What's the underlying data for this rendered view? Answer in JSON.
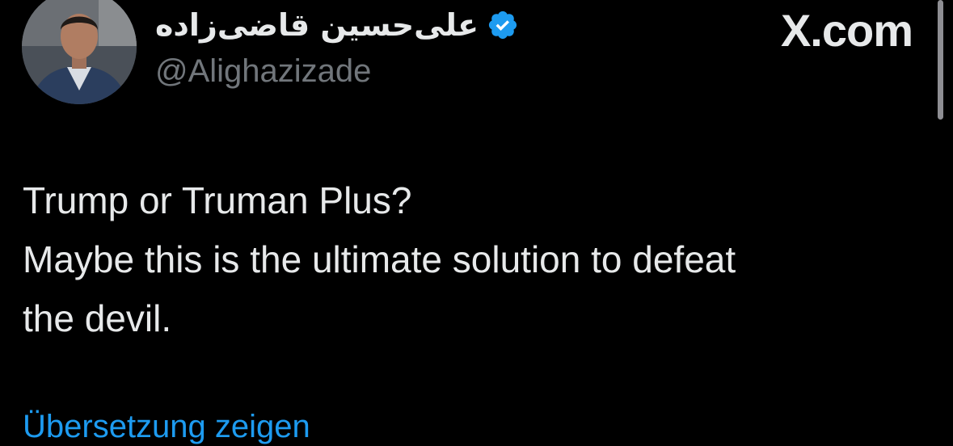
{
  "author": {
    "display_name": "علی‌حسین قاضی‌زاده",
    "handle": "@Alighazizade",
    "verified": true,
    "avatar_icon": "profile-photo"
  },
  "brand": {
    "label": "X.com"
  },
  "tweet": {
    "lines": [
      "Trump or Truman Plus?",
      "Maybe this is the ultimate solution to defeat",
      "the devil."
    ]
  },
  "translate": {
    "label": "Übersetzung zeigen"
  },
  "colors": {
    "background": "#000000",
    "text_primary": "#e7e9ea",
    "text_secondary": "#71767b",
    "link": "#1d9bf0",
    "verified_badge": "#1d9bf0"
  },
  "icons": {
    "verified": "verified-badge-icon"
  }
}
